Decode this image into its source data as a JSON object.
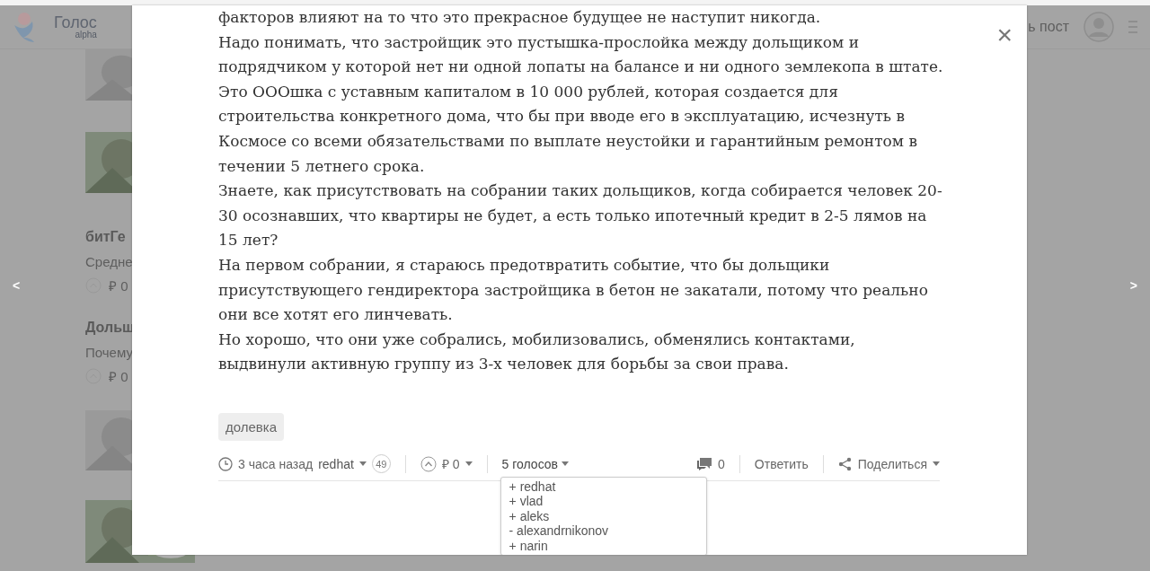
{
  "background": {
    "logo": {
      "name": "Голос",
      "sub": "alpha"
    },
    "header_link": "ь пост",
    "feed": [
      {
        "kind": "picture"
      },
      {
        "kind": "picture"
      },
      {
        "kind": "post",
        "title": "битГе",
        "excerpt": "Средне",
        "payout": "₽ 0"
      },
      {
        "kind": "post",
        "title": "Дольш",
        "excerpt": "Почему",
        "payout": "₽ 0"
      },
      {
        "kind": "picture"
      },
      {
        "kind": "picture"
      }
    ],
    "prev": "<",
    "next": ">"
  },
  "modal": {
    "close": "×",
    "paragraphs": [
      "факторов влияют на то что это прекрасное будущее не наступит никогда.",
      "Надо понимать, что застройщик это пустышка-прослойка между дольщиком и подрядчиком у которой нет ни одной лопаты на балансе и ни одного землекопа в штате.",
      "Это ОООшка с уставным капиталом в 10 000 рублей, которая создается для строительства конкретного дома, что бы при вводе его в эксплуатацию, исчезнуть в Космосе со всеми обязательствами по выплате неустойки и гарантийным ремонтом в течении 5 летнего срока.",
      "Знаете, как присутствовать на собрании таких дольщиков, когда собирается человек 20-30 осознавших, что квартиры не будет, а есть только ипотечный кредит в 2-5 лямов на 15 лет?",
      "На первом собрании, я стараюсь предотвратить событие, что бы дольщики присутствующего гендиректора застройщика в бетон не закатали, потому что реально они все хотят его линчевать.",
      "Но хорошо, что они уже собрались, мобилизовались, обменялись контактами, выдвинули активную группу из 3-х человек для борьбы за свои права."
    ],
    "tags": [
      "долевка"
    ],
    "meta": {
      "time": "3 часа назад",
      "author": "redhat",
      "reputation": "49",
      "payout": "₽ 0",
      "votes": {
        "label": "5 голосов",
        "expanded": true,
        "voters": [
          "+ redhat",
          "+ vlad",
          "+ aleks",
          "- alexandrnikonov",
          "+ narin"
        ]
      },
      "comments": "0",
      "reply": "Ответить",
      "share": "Поделиться"
    }
  }
}
